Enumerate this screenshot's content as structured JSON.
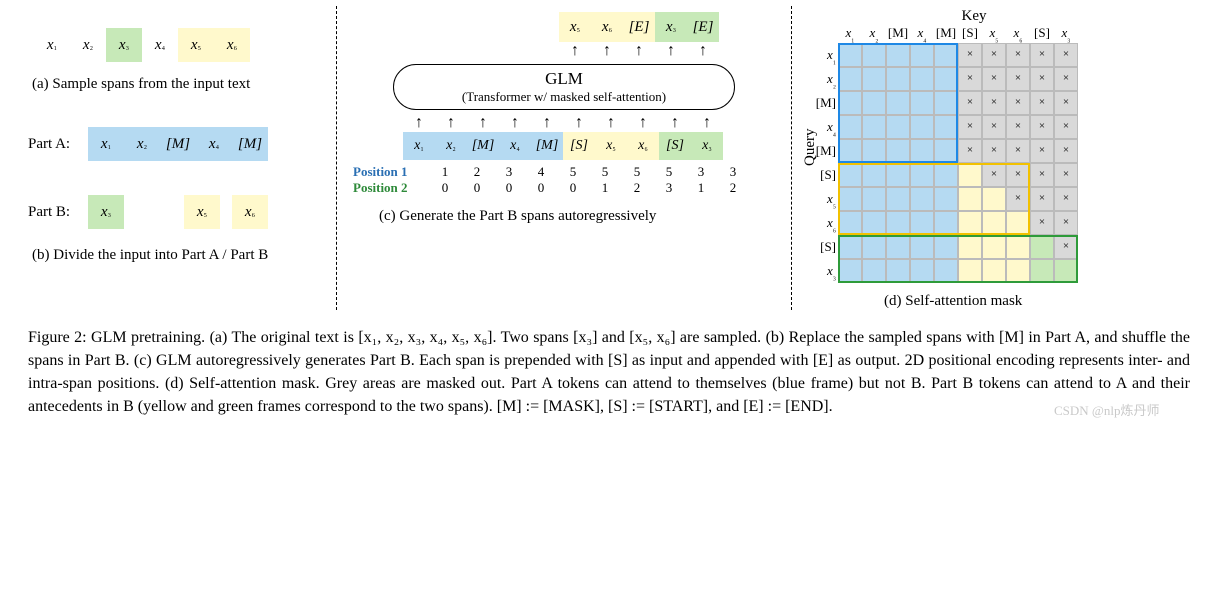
{
  "panelA": {
    "tokens": [
      "x₁",
      "x₂",
      "x₃",
      "x₄",
      "x₅",
      "x₆"
    ],
    "token_styles": [
      "plain",
      "plain",
      "green",
      "plain",
      "yellow",
      "yellow"
    ],
    "caption": "(a)  Sample spans from the input text",
    "partA_label": "Part A:",
    "partA_tokens": [
      "x₁",
      "x₂",
      "[M]",
      "x₄",
      "[M]"
    ],
    "partB_label": "Part B:",
    "partB_tokens": [
      "x₃",
      "",
      "x₅",
      "x₆"
    ],
    "partB_styles": [
      "green",
      "plain",
      "yellow",
      "yellow"
    ],
    "captionB": "(b)  Divide the input into Part A / Part B"
  },
  "panelC": {
    "out_tokens": [
      "x₅",
      "x₆",
      "[E]",
      "x₃",
      "[E]"
    ],
    "out_styles": [
      "yellow",
      "yellow",
      "yellow",
      "green",
      "green"
    ],
    "glm_title": "GLM",
    "glm_sub": "(Transformer w/ masked self-attention)",
    "in_tokens": [
      "x₁",
      "x₂",
      "[M]",
      "x₄",
      "[M]",
      "[S]",
      "x₅",
      "x₆",
      "[S]",
      "x₃"
    ],
    "in_styles": [
      "blue",
      "blue",
      "blue",
      "blue",
      "blue",
      "yellow",
      "yellow",
      "yellow",
      "green",
      "green"
    ],
    "pos1_label": "Position 1",
    "pos1": [
      "1",
      "2",
      "3",
      "4",
      "5",
      "5",
      "5",
      "5",
      "3",
      "3"
    ],
    "pos2_label": "Position 2",
    "pos2": [
      "0",
      "0",
      "0",
      "0",
      "0",
      "1",
      "2",
      "3",
      "1",
      "2"
    ],
    "caption": "(c)  Generate the Part B spans autoregressively"
  },
  "panelD": {
    "key_title": "Key",
    "query_title": "Query",
    "headers": [
      "x₁",
      "x₂",
      "[M]",
      "x₄",
      "[M]",
      "[S]",
      "x₅",
      "x₆",
      "[S]",
      "x₃"
    ],
    "row_labels": [
      "x₁",
      "x₂",
      "[M]",
      "x₄",
      "[M]",
      "[S]",
      "x₅",
      "x₆",
      "[S]",
      "x₃"
    ],
    "mask_x": "×",
    "caption": "(d)  Self-attention mask"
  },
  "caption": "Figure 2: GLM pretraining. (a) The original text is [x₁, x₂, x₃, x₄, x₅, x₆]. Two spans [x₃] and [x₅, x₆] are sampled. (b) Replace the sampled spans with [M] in Part A, and shuffle the spans in Part B. (c) GLM autoregressively generates Part B. Each span is prepended with [S] as input and appended with [E] as output. 2D positional encoding represents inter- and intra-span positions. (d) Self-attention mask. Grey areas are masked out. Part A tokens can attend to themselves (blue frame) but not B. Part B tokens can attend to A and their antecedents in B (yellow and green frames correspond to the two spans). [M] := [MASK], [S] := [START], and [E] := [END].",
  "watermark": "CSDN @nlp炼丹师"
}
